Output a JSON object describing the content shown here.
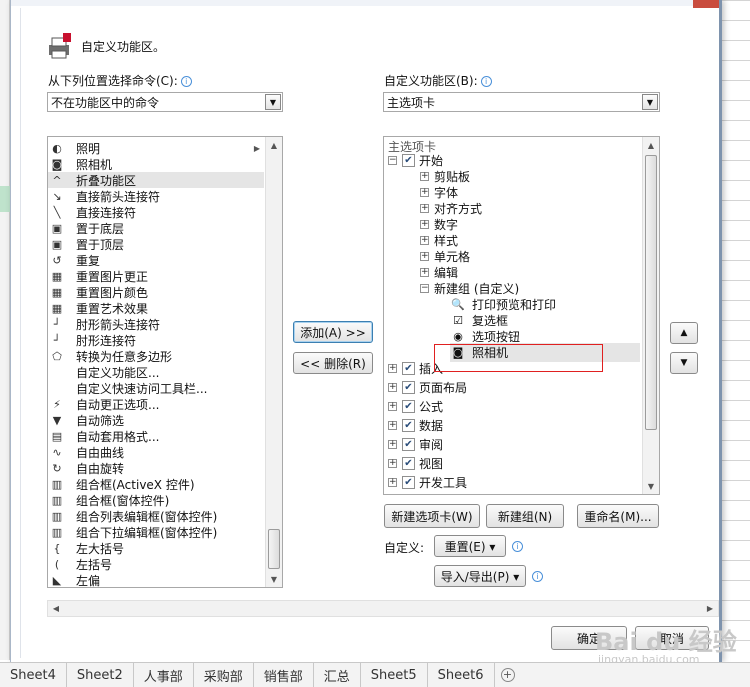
{
  "header": {
    "title": "自定义功能区。"
  },
  "left": {
    "label": "从下列位置选择命令(C):",
    "dropdown_value": "不在功能区中的命令",
    "commands": [
      {
        "label": "照明",
        "icon": "bulb-icon",
        "submenu": true
      },
      {
        "label": "照相机",
        "icon": "camera-icon"
      },
      {
        "label": "折叠功能区",
        "icon": "collapse-icon",
        "selected": true
      },
      {
        "label": "直接箭头连接符",
        "icon": "arrow-connector-icon"
      },
      {
        "label": "直接连接符",
        "icon": "line-connector-icon"
      },
      {
        "label": "置于底层",
        "icon": "send-back-icon"
      },
      {
        "label": "置于顶层",
        "icon": "bring-front-icon"
      },
      {
        "label": "重复",
        "icon": "repeat-icon"
      },
      {
        "label": "重置图片更正",
        "icon": "reset-picture-icon"
      },
      {
        "label": "重置图片颜色",
        "icon": "reset-color-icon"
      },
      {
        "label": "重置艺术效果",
        "icon": "reset-art-icon"
      },
      {
        "label": "肘形箭头连接符",
        "icon": "elbow-arrow-icon"
      },
      {
        "label": "肘形连接符",
        "icon": "elbow-connector-icon"
      },
      {
        "label": "转换为任意多边形",
        "icon": "polygon-icon"
      },
      {
        "label": "自定义功能区...",
        "icon": "blank-icon"
      },
      {
        "label": "自定义快速访问工具栏...",
        "icon": "blank-icon"
      },
      {
        "label": "自动更正选项...",
        "icon": "autocorrect-icon"
      },
      {
        "label": "自动筛选",
        "icon": "filter-icon"
      },
      {
        "label": "自动套用格式...",
        "icon": "autoformat-icon"
      },
      {
        "label": "自由曲线",
        "icon": "freeform-icon"
      },
      {
        "label": "自由旋转",
        "icon": "rotate-icon"
      },
      {
        "label": "组合框(ActiveX 控件)",
        "icon": "combo-activex-icon"
      },
      {
        "label": "组合框(窗体控件)",
        "icon": "combo-form-icon"
      },
      {
        "label": "组合列表编辑框(窗体控件)",
        "icon": "combo-list-icon"
      },
      {
        "label": "组合下拉编辑框(窗体控件)",
        "icon": "combo-dropdown-icon"
      },
      {
        "label": "左大括号",
        "icon": "left-brace-icon"
      },
      {
        "label": "左括号",
        "icon": "left-bracket-icon"
      },
      {
        "label": "左偏",
        "icon": "left-skew-icon"
      }
    ]
  },
  "middle": {
    "add_label": "添加(A) >>",
    "remove_label": "<< 删除(R)"
  },
  "right": {
    "label": "自定义功能区(B):",
    "dropdown_value": "主选项卡",
    "tree_header": "主选项卡",
    "tree": [
      {
        "level": 0,
        "label": "开始",
        "expander": "⊟",
        "check": true
      },
      {
        "level": 1,
        "label": "剪贴板",
        "expander": "⊞"
      },
      {
        "level": 1,
        "label": "字体",
        "expander": "⊞"
      },
      {
        "level": 1,
        "label": "对齐方式",
        "expander": "⊞"
      },
      {
        "level": 1,
        "label": "数字",
        "expander": "⊞"
      },
      {
        "level": 1,
        "label": "样式",
        "expander": "⊞"
      },
      {
        "level": 1,
        "label": "单元格",
        "expander": "⊞"
      },
      {
        "level": 1,
        "label": "编辑",
        "expander": "⊞"
      },
      {
        "level": 1,
        "label": "新建组 (自定义)",
        "expander": "⊟"
      },
      {
        "level": 2,
        "label": "打印预览和打印",
        "icon": "print-preview-icon"
      },
      {
        "level": 2,
        "label": "复选框",
        "icon": "checkbox-icon"
      },
      {
        "level": 2,
        "label": "选项按钮",
        "icon": "radio-icon"
      },
      {
        "level": 2,
        "label": "照相机",
        "icon": "camera-icon",
        "selected": true
      },
      {
        "level": 0,
        "label": "插入",
        "expander": "⊞",
        "check": true
      },
      {
        "level": 0,
        "label": "页面布局",
        "expander": "⊞",
        "check": true
      },
      {
        "level": 0,
        "label": "公式",
        "expander": "⊞",
        "check": true
      },
      {
        "level": 0,
        "label": "数据",
        "expander": "⊞",
        "check": true
      },
      {
        "level": 0,
        "label": "审阅",
        "expander": "⊞",
        "check": true
      },
      {
        "level": 0,
        "label": "视图",
        "expander": "⊞",
        "check": true
      },
      {
        "level": 0,
        "label": "开发工具",
        "expander": "⊞",
        "check": true
      }
    ],
    "new_tab_label": "新建选项卡(W)",
    "new_group_label": "新建组(N)",
    "rename_label": "重命名(M)...",
    "custom_label": "自定义:",
    "reset_label": "重置(E) ▾",
    "import_export_label": "导入/导出(P) ▾",
    "move_up": "▲",
    "move_down": "▼"
  },
  "footer": {
    "ok_label": "确定",
    "cancel_label": "取消"
  },
  "sheets": [
    "Sheet4",
    "Sheet2",
    "人事部",
    "采购部",
    "销售部",
    "汇总",
    "Sheet5",
    "Sheet6"
  ],
  "watermark": {
    "text": "Bai du 经验",
    "sub": "jingyan.baidu.com"
  }
}
